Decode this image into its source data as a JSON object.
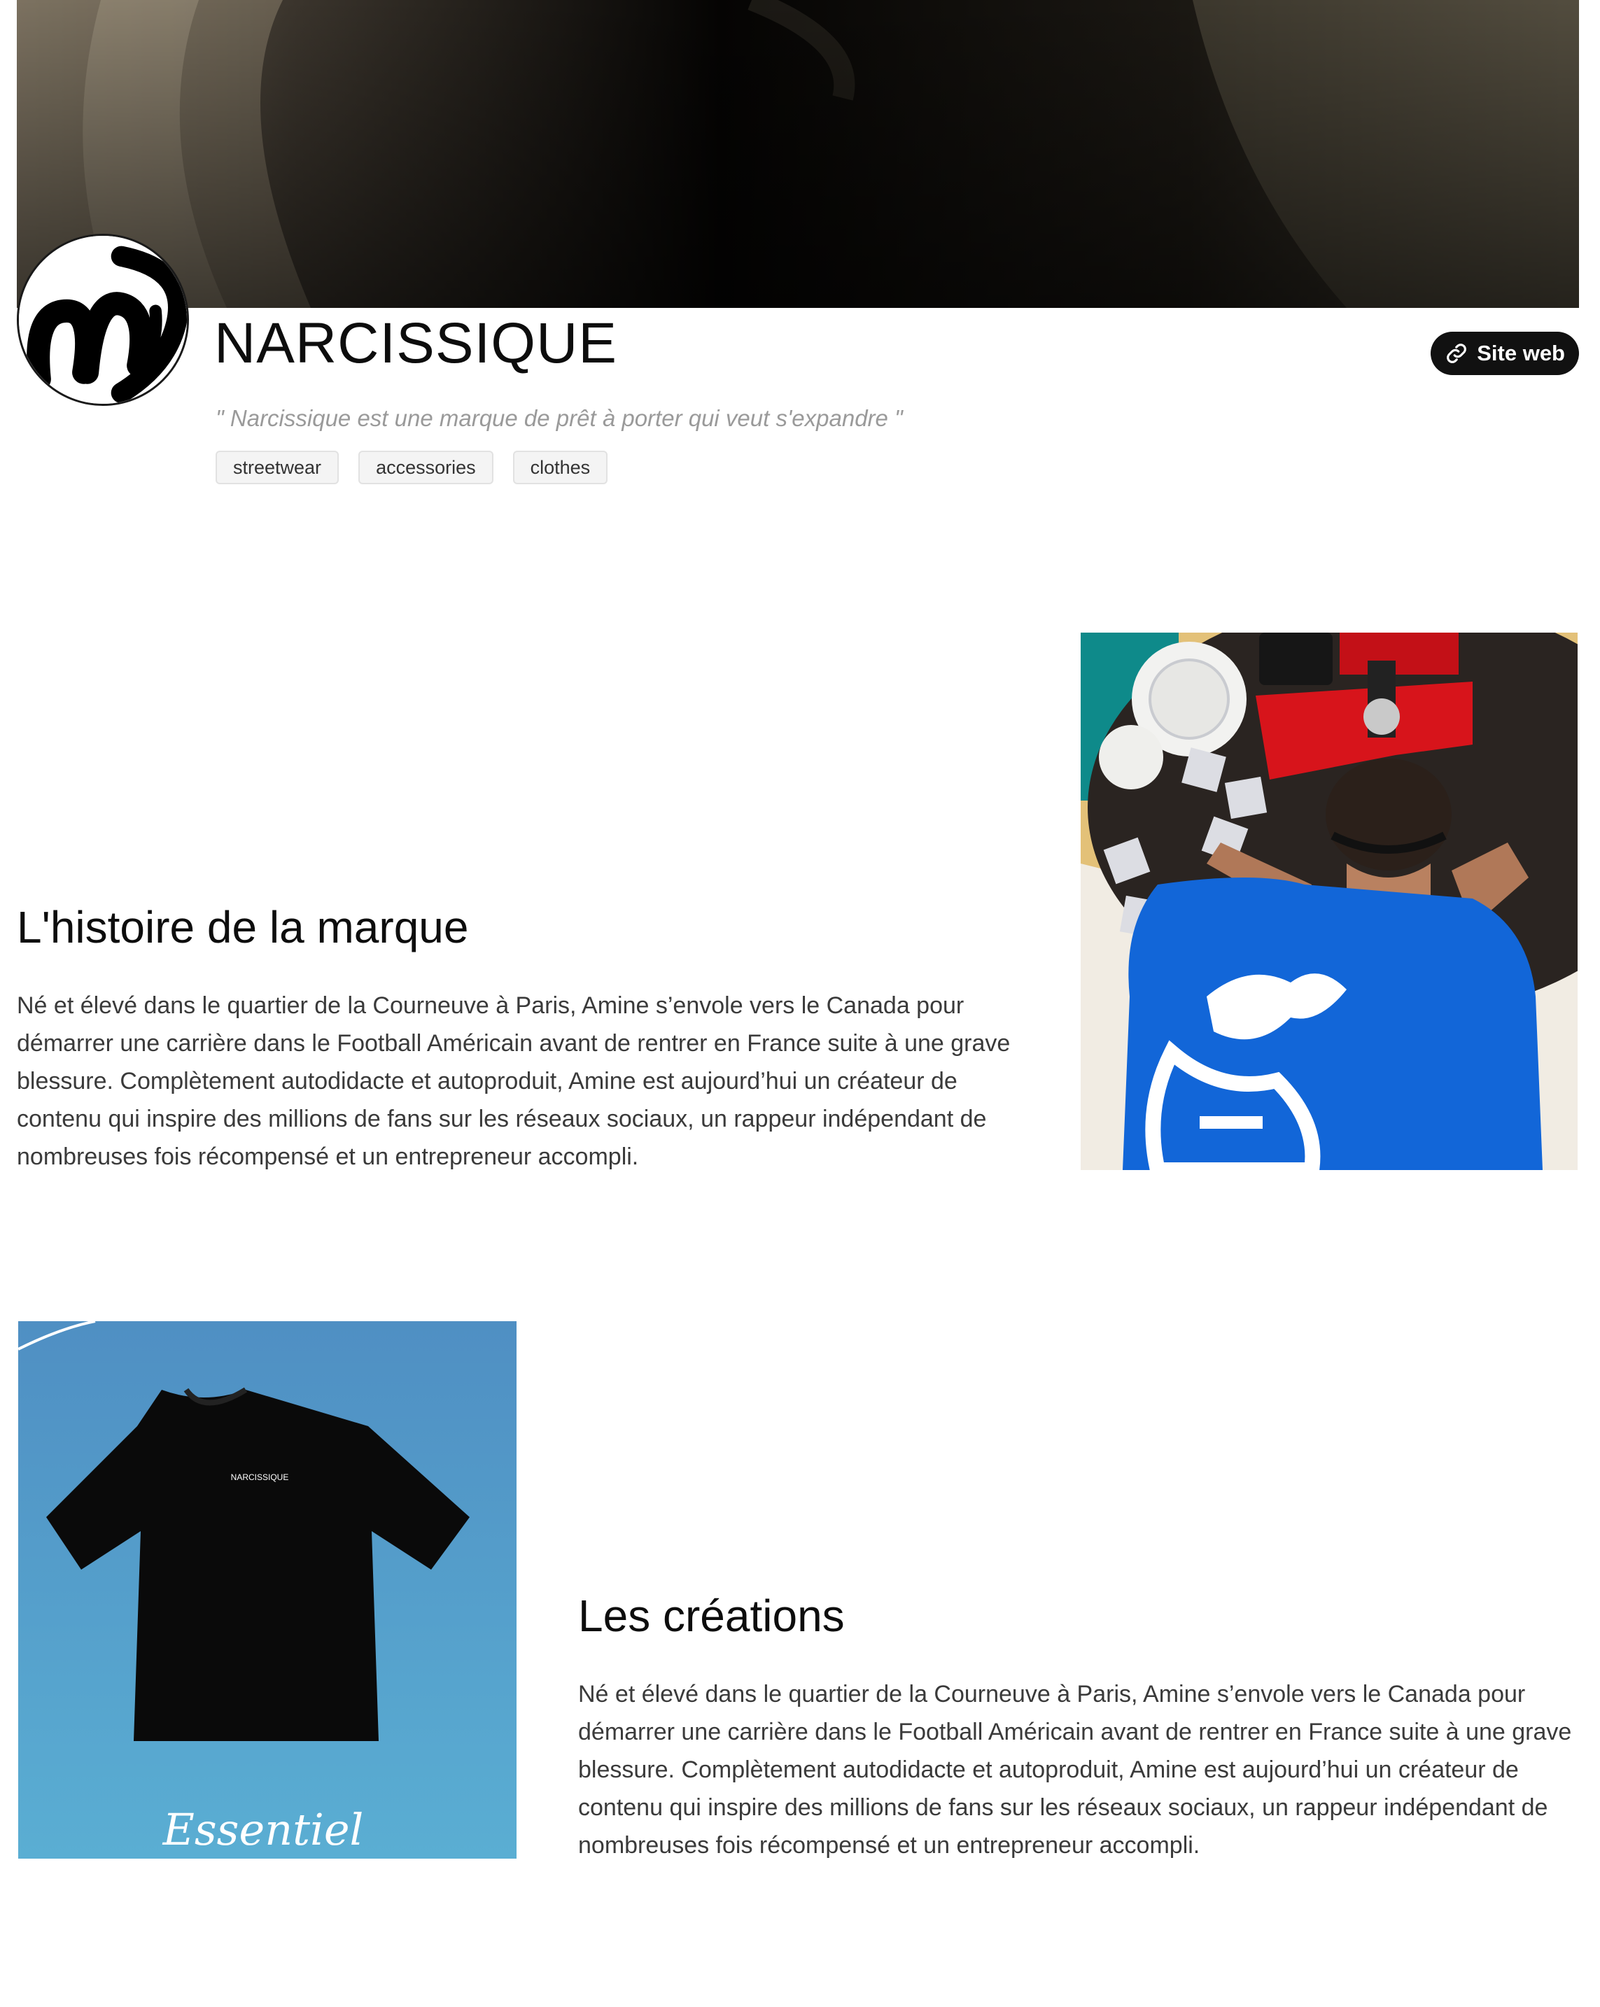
{
  "brand": {
    "name": "NARCISSIQUE",
    "tagline": "\" Narcissique est une marque de prêt à porter qui veut s'expandre \"",
    "logo_icon": "brand-logo-icon"
  },
  "header": {
    "website_button_label": "Site web",
    "website_icon": "link-icon"
  },
  "tags": [
    "streetwear",
    "accessories",
    "clothes"
  ],
  "sections": [
    {
      "title": "L'histoire de la marque",
      "text": "Né et élevé dans le quartier de la Courneuve à Paris, Amine s’envole vers le Canada pour démarrer une carrière dans le Football Américain avant de rentrer en France suite à une grave blessure. Complètement autodidacte et autoproduit, Amine est aujourd’hui un créateur de contenu qui inspire des millions de fans sur les réseaux sociaux, un rappeur indépendant de nombreuses fois récompensé et un entrepreneur accompli."
    },
    {
      "title": "Les créations",
      "text": "Né et élevé dans le quartier de la Courneuve à Paris, Amine s’envole vers le Canada pour démarrer une carrière dans le Football Américain avant de rentrer en France suite à une grave blessure. Complètement autodidacte et autoproduit, Amine est aujourd’hui un créateur de contenu qui inspire des millions de fans sur les réseaux sociaux, un rappeur indépendant de nombreuses fois récompensé et un entrepreneur accompli."
    }
  ],
  "images": {
    "creations_tshirt_print": "NARCISSIQUE",
    "creations_script": "Essentiel"
  },
  "colors": {
    "accent": "#111111",
    "tag_bg": "#f4f4f4",
    "tagline": "#9a9a9a",
    "body_text": "#3a3a3a",
    "sky_blue": "#4f98c9",
    "shirt_blue": "#1266d8",
    "press_red": "#d7141b"
  }
}
